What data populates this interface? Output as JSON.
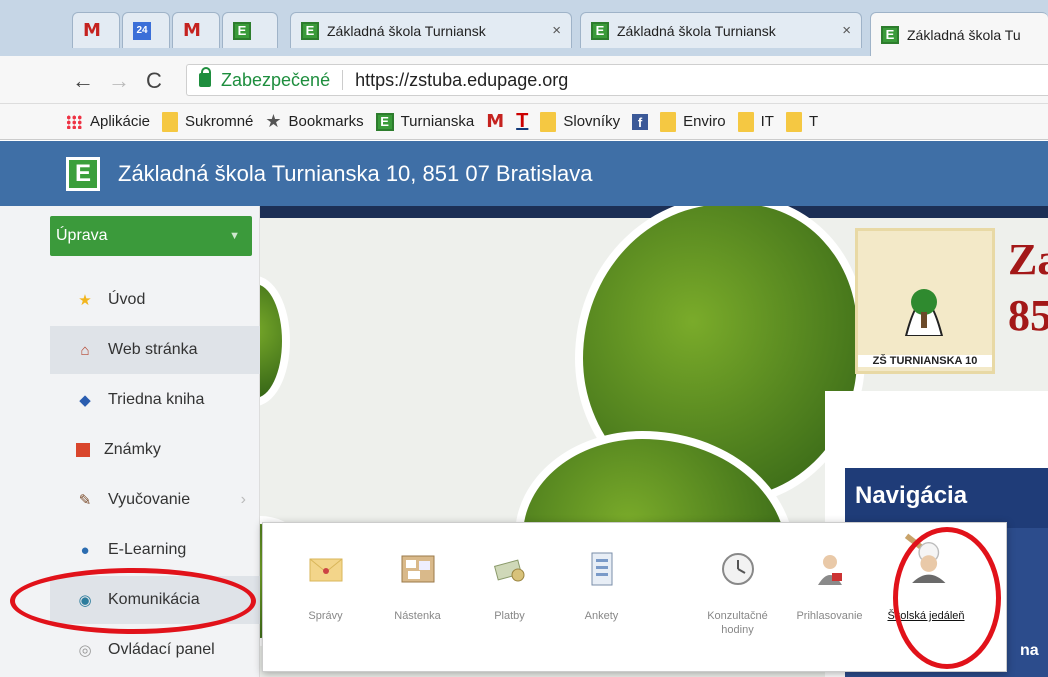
{
  "browser": {
    "tabs": [
      {
        "icon": "gmail-icon",
        "title": ""
      },
      {
        "icon": "calendar-icon",
        "title": "24"
      },
      {
        "icon": "gmail-icon",
        "title": ""
      },
      {
        "icon": "edupage-icon",
        "title": ""
      },
      {
        "icon": "edupage-icon",
        "title": "Základná škola Turniansk"
      },
      {
        "icon": "edupage-icon",
        "title": "Základná škola Turniansk"
      },
      {
        "icon": "edupage-icon",
        "title": "Základná škola Tu"
      }
    ],
    "close_glyph": "×",
    "address": {
      "secure_label": "Zabezpečené",
      "url": "https://zstuba.edupage.org"
    },
    "bookmarks": [
      {
        "icon": "apps-icon",
        "label": "Aplikácie"
      },
      {
        "icon": "folder-icon",
        "label": "Sukromné"
      },
      {
        "icon": "star-icon",
        "label": "Bookmarks"
      },
      {
        "icon": "edupage-icon",
        "label": "Turnianska"
      },
      {
        "icon": "gmail-icon",
        "label": ""
      },
      {
        "icon": "t-icon",
        "label": ""
      },
      {
        "icon": "folder-icon",
        "label": "Slovníky"
      },
      {
        "icon": "facebook-icon",
        "label": ""
      },
      {
        "icon": "folder-icon",
        "label": "Enviro"
      },
      {
        "icon": "folder-icon",
        "label": "IT"
      },
      {
        "icon": "folder-icon",
        "label": "T"
      }
    ]
  },
  "header": {
    "logo_letter": "E",
    "title": "Základná škola Turnianska 10, 851 07 Bratislava"
  },
  "sidebar": {
    "edit_label": "Úprava",
    "items": [
      {
        "label": "Úvod",
        "icon": "star-icon"
      },
      {
        "label": "Web stránka",
        "icon": "house-icon"
      },
      {
        "label": "Triedna kniha",
        "icon": "book-icon"
      },
      {
        "label": "Známky",
        "icon": "grades-icon"
      },
      {
        "label": "Vyučovanie",
        "icon": "teaching-icon"
      },
      {
        "label": "E-Learning",
        "icon": "elearning-icon"
      },
      {
        "label": "Komunikácia",
        "icon": "communication-icon"
      },
      {
        "label": "Ovládací panel",
        "icon": "settings-icon"
      }
    ]
  },
  "banner": {
    "logo_label": "ZŠ TURNIANSKA 10",
    "school_name_line1": "Za",
    "school_name_line2": "85",
    "nav_title": "Navigácia",
    "nav_partial": "na"
  },
  "popup": {
    "items": [
      {
        "label": "Správy",
        "icon": "envelope-icon"
      },
      {
        "label": "Nástenka",
        "icon": "noticeboard-icon"
      },
      {
        "label": "Platby",
        "icon": "payments-icon"
      },
      {
        "label": "Ankety",
        "icon": "survey-icon"
      },
      {
        "label": "Konzultačné hodiny",
        "icon": "clock-icon"
      },
      {
        "label": "Prihlasovanie",
        "icon": "login-person-icon"
      },
      {
        "label": "Školská jedáleň",
        "icon": "chef-icon"
      }
    ]
  },
  "colors": {
    "header_bg": "#3f6fa6",
    "edit_btn": "#3b9a3b",
    "annotation_red": "#e1121a",
    "nav_title_bg": "#1f3c78"
  }
}
